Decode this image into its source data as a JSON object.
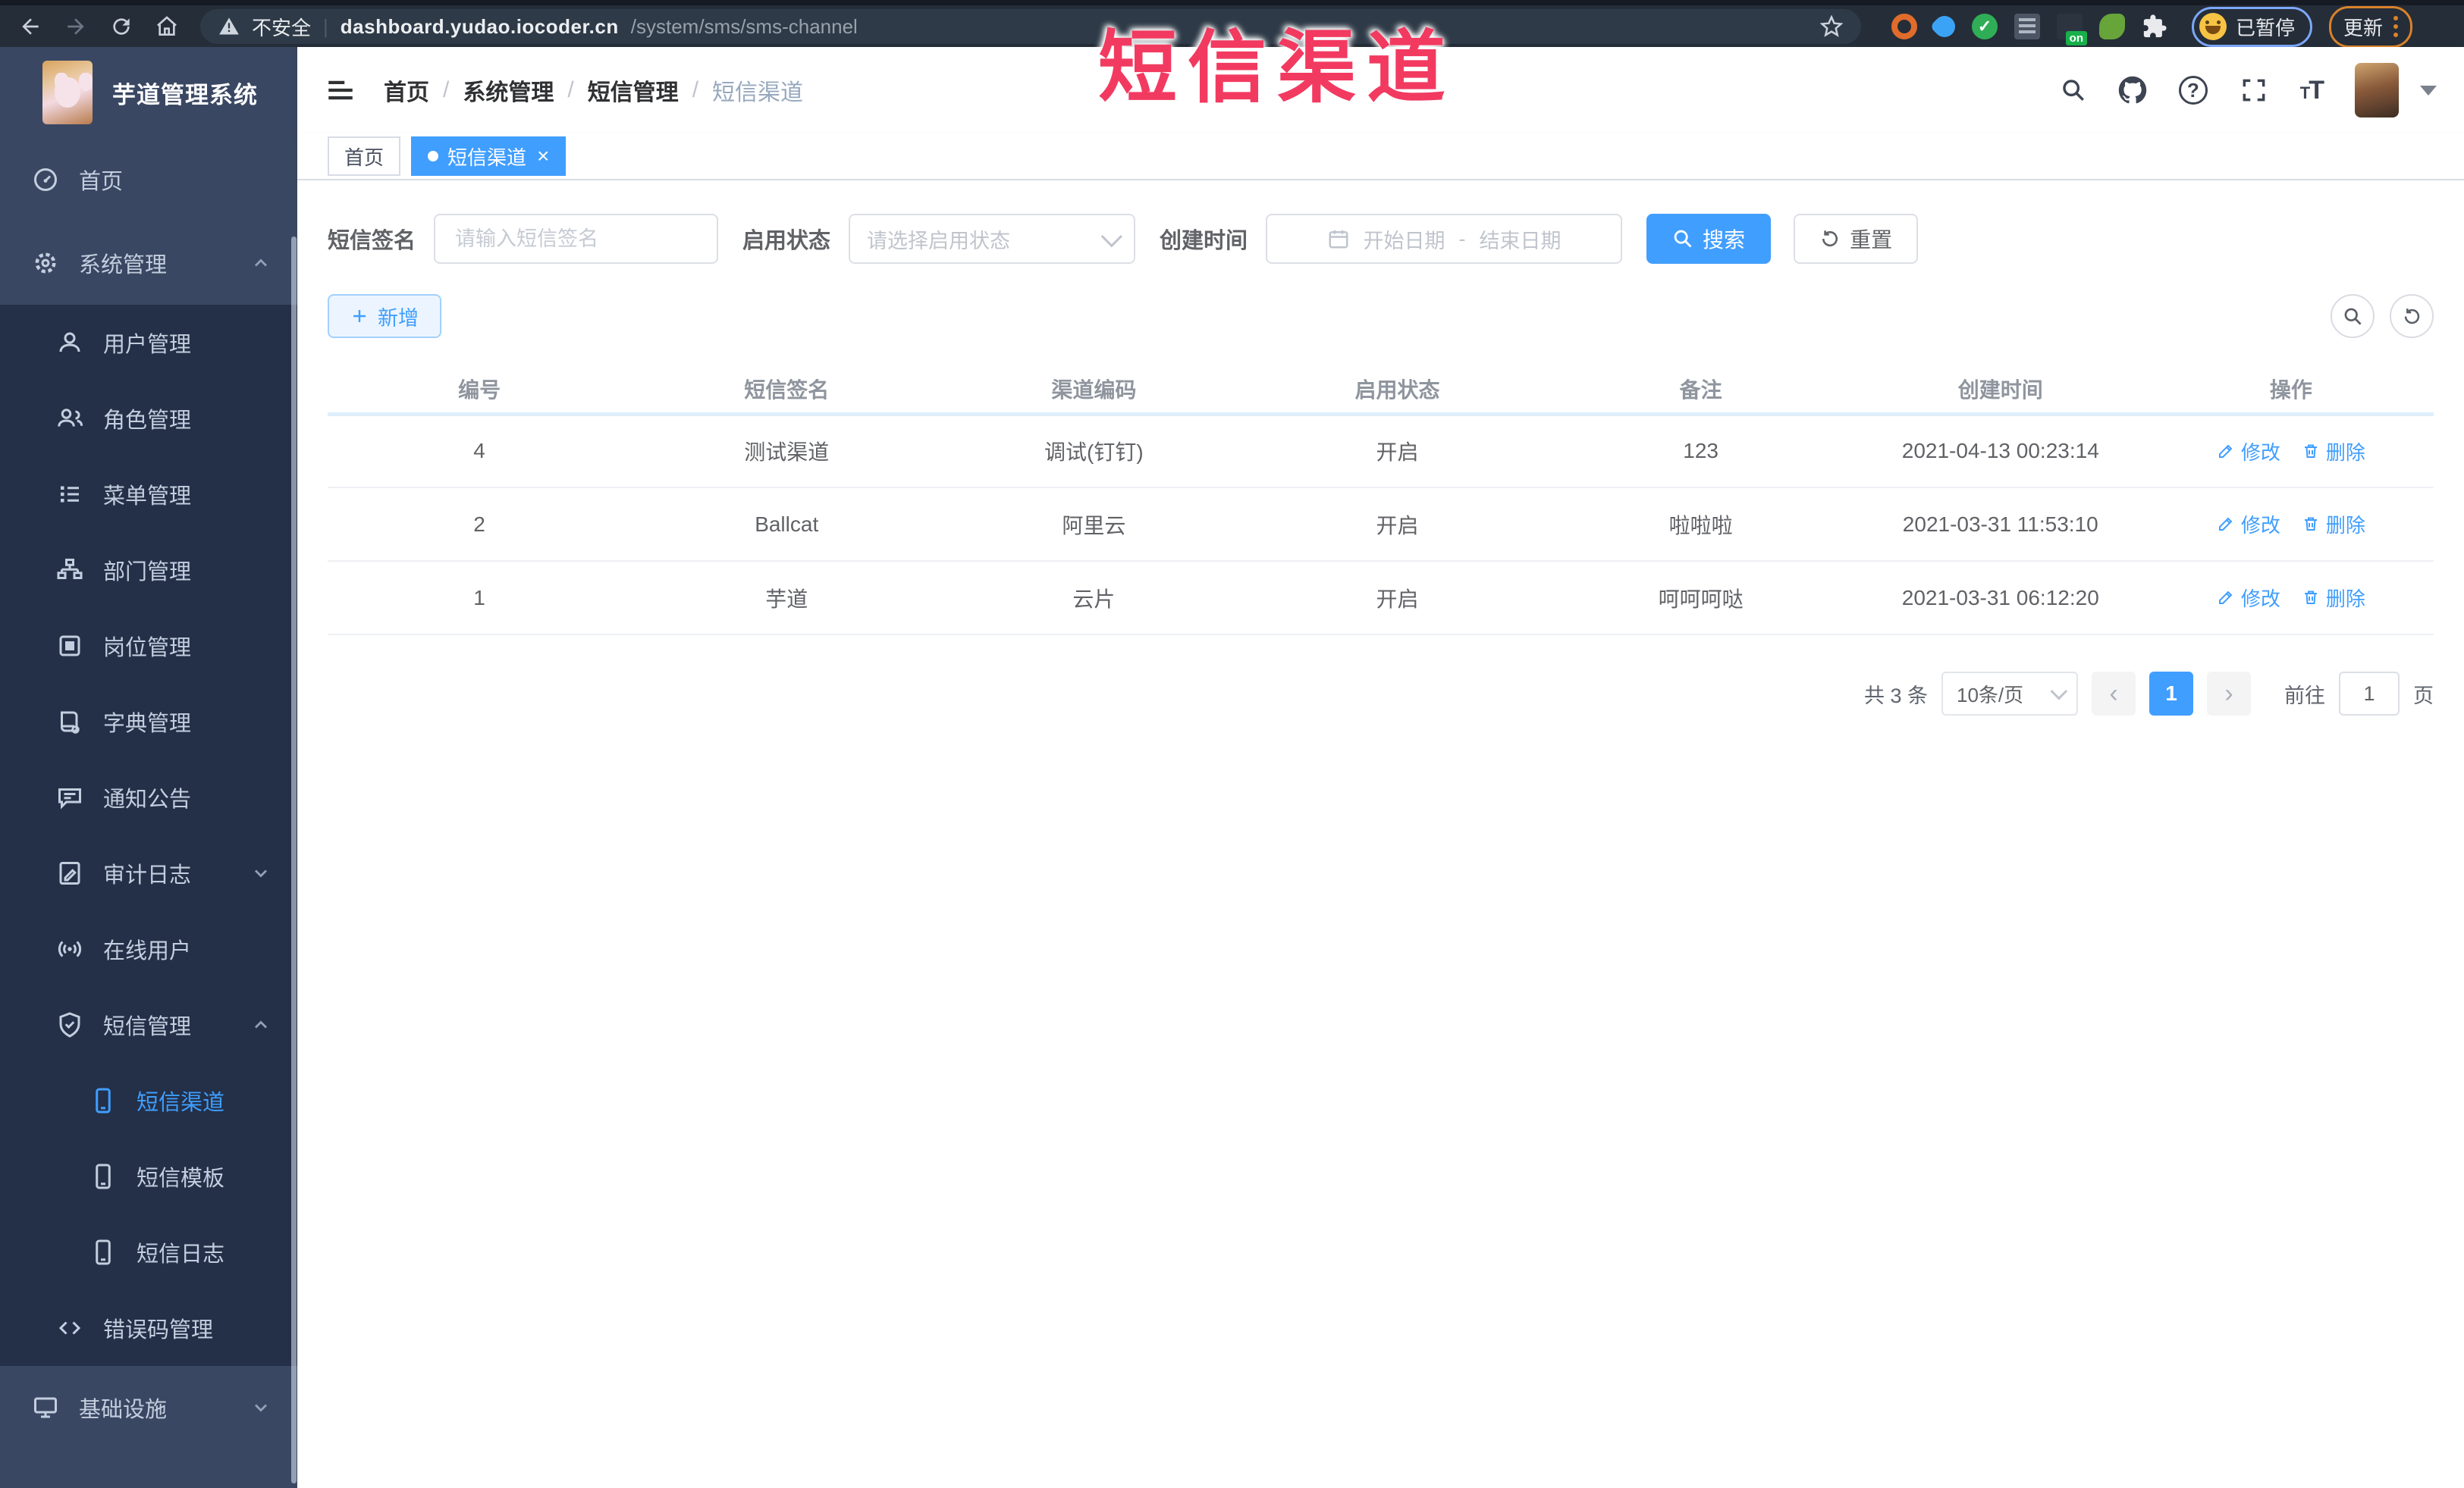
{
  "browser": {
    "security_label": "不安全",
    "url_host": "dashboard.yudao.iocoder.cn",
    "url_path": "/system/sms/sms-channel",
    "badge_label": "on",
    "profile_status": "已暂停",
    "update_label": "更新"
  },
  "annotation": {
    "text": "短信渠道",
    "color": "#f23a60"
  },
  "sidebar": {
    "title": "芋道管理系统",
    "items": [
      {
        "key": "home",
        "label": "首页",
        "icon": "dashboard-icon",
        "level": 1,
        "zone": "base"
      },
      {
        "key": "system",
        "label": "系统管理",
        "icon": "gear-icon",
        "level": 1,
        "zone": "base",
        "chevron": "up"
      },
      {
        "key": "users",
        "label": "用户管理",
        "icon": "user-icon",
        "level": 2,
        "zone": "sub"
      },
      {
        "key": "roles",
        "label": "角色管理",
        "icon": "roles-icon",
        "level": 2,
        "zone": "sub"
      },
      {
        "key": "menus",
        "label": "菜单管理",
        "icon": "menu-list-icon",
        "level": 2,
        "zone": "sub"
      },
      {
        "key": "depts",
        "label": "部门管理",
        "icon": "org-tree-icon",
        "level": 2,
        "zone": "sub"
      },
      {
        "key": "posts",
        "label": "岗位管理",
        "icon": "badge-icon",
        "level": 2,
        "zone": "sub"
      },
      {
        "key": "dict",
        "label": "字典管理",
        "icon": "dictionary-icon",
        "level": 2,
        "zone": "sub"
      },
      {
        "key": "notice",
        "label": "通知公告",
        "icon": "announcement-icon",
        "level": 2,
        "zone": "sub"
      },
      {
        "key": "audit-log",
        "label": "审计日志",
        "icon": "audit-log-icon",
        "level": 2,
        "zone": "sub",
        "chevron": "down"
      },
      {
        "key": "online-users",
        "label": "在线用户",
        "icon": "online-users-icon",
        "level": 2,
        "zone": "sub"
      },
      {
        "key": "sms",
        "label": "短信管理",
        "icon": "shield-icon",
        "level": 2,
        "zone": "sub",
        "chevron": "up"
      },
      {
        "key": "sms-channel",
        "label": "短信渠道",
        "icon": "phone-icon",
        "level": 3,
        "zone": "sub",
        "active": true
      },
      {
        "key": "sms-template",
        "label": "短信模板",
        "icon": "phone-icon",
        "level": 3,
        "zone": "sub"
      },
      {
        "key": "sms-log",
        "label": "短信日志",
        "icon": "phone-icon",
        "level": 3,
        "zone": "sub"
      },
      {
        "key": "error-code",
        "label": "错误码管理",
        "icon": "code-icon",
        "level": 2,
        "zone": "sub"
      },
      {
        "key": "infra",
        "label": "基础设施",
        "icon": "monitor-icon",
        "level": 1,
        "zone": "base",
        "chevron": "down"
      }
    ]
  },
  "header": {
    "breadcrumb": [
      "首页",
      "系统管理",
      "短信管理",
      "短信渠道"
    ]
  },
  "tabs": [
    {
      "label": "首页",
      "active": false,
      "closable": false
    },
    {
      "label": "短信渠道",
      "active": true,
      "closable": true
    }
  ],
  "filters": {
    "sign_label": "短信签名",
    "sign_placeholder": "请输入短信签名",
    "status_label": "启用状态",
    "status_placeholder": "请选择启用状态",
    "time_label": "创建时间",
    "start_placeholder": "开始日期",
    "range_separator": "-",
    "end_placeholder": "结束日期",
    "search_label": "搜索",
    "reset_label": "重置"
  },
  "toolbar": {
    "add_label": "新增"
  },
  "table": {
    "columns": [
      "编号",
      "短信签名",
      "渠道编码",
      "启用状态",
      "备注",
      "创建时间",
      "操作"
    ],
    "edit_label": "修改",
    "delete_label": "删除",
    "rows": [
      {
        "id": "4",
        "sign": "测试渠道",
        "code": "调试(钉钉)",
        "status": "开启",
        "remark": "123",
        "created": "2021-04-13 00:23:14"
      },
      {
        "id": "2",
        "sign": "Ballcat",
        "code": "阿里云",
        "status": "开启",
        "remark": "啦啦啦",
        "created": "2021-03-31 11:53:10"
      },
      {
        "id": "1",
        "sign": "芋道",
        "code": "云片",
        "status": "开启",
        "remark": "呵呵呵哒",
        "created": "2021-03-31 06:12:20"
      }
    ]
  },
  "pagination": {
    "total_label": "共 3 条",
    "page_size": "10条/页",
    "current_page": "1",
    "prev_icon": "‹",
    "next_icon": "›",
    "goto_label": "前往",
    "goto_value": "1",
    "page_label": "页"
  },
  "accent_colors": {
    "primary": "#409eff",
    "sidebar_base": "#3a4763",
    "sidebar_sub": "#233048",
    "annotation": "#f23a60"
  }
}
